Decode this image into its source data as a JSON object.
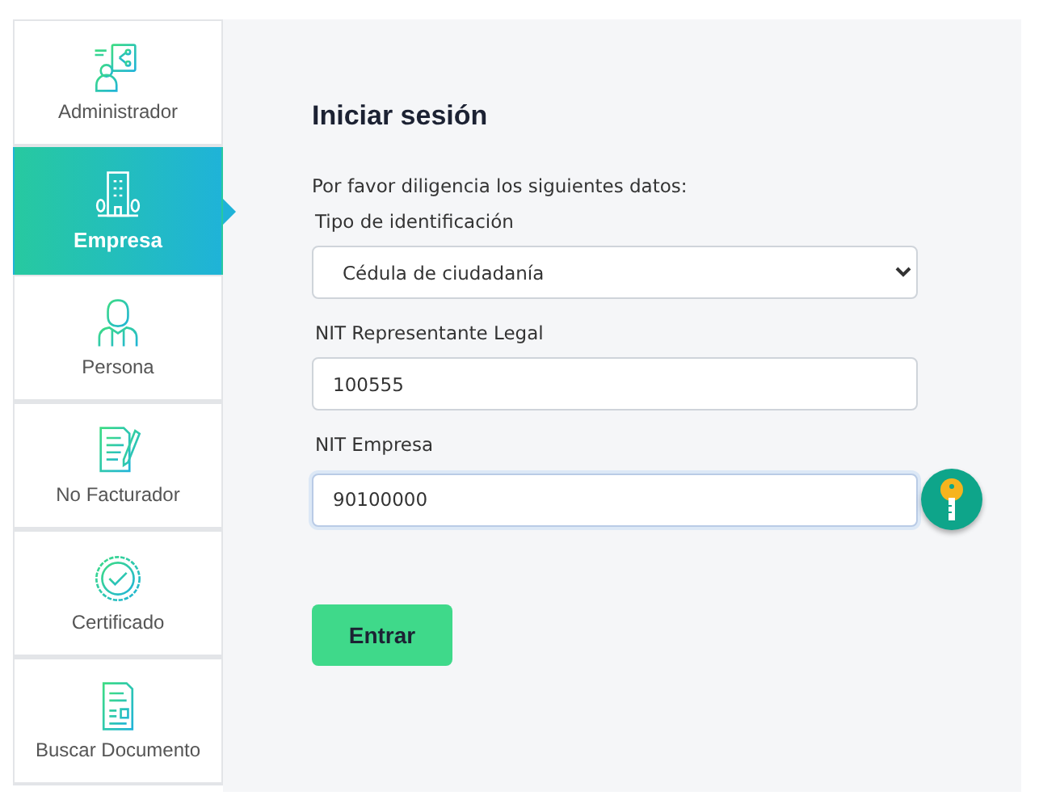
{
  "sidebar": {
    "items": [
      {
        "label": "Administrador",
        "kind": "admin",
        "selected": false
      },
      {
        "label": "Empresa",
        "kind": "building",
        "selected": true
      },
      {
        "label": "Persona",
        "kind": "person",
        "selected": false
      },
      {
        "label": "No Facturador",
        "kind": "notepad",
        "selected": false
      },
      {
        "label": "Certificado",
        "kind": "seal",
        "selected": false
      },
      {
        "label": "Buscar Documento",
        "kind": "document",
        "selected": false
      }
    ]
  },
  "form": {
    "title": "Iniciar sesión",
    "intro": "Por favor diligencia los siguientes datos:",
    "fields": [
      {
        "kind": "select",
        "label": "Tipo de identificación",
        "value": "Cédula de ciudadanía",
        "focused": false
      },
      {
        "kind": "text",
        "label": "NIT Representante Legal",
        "value": "100555",
        "focused": false
      },
      {
        "kind": "text",
        "label": "NIT Empresa",
        "value": "90100000",
        "focused": true,
        "key_button": true
      }
    ],
    "submit": "Entrar"
  }
}
